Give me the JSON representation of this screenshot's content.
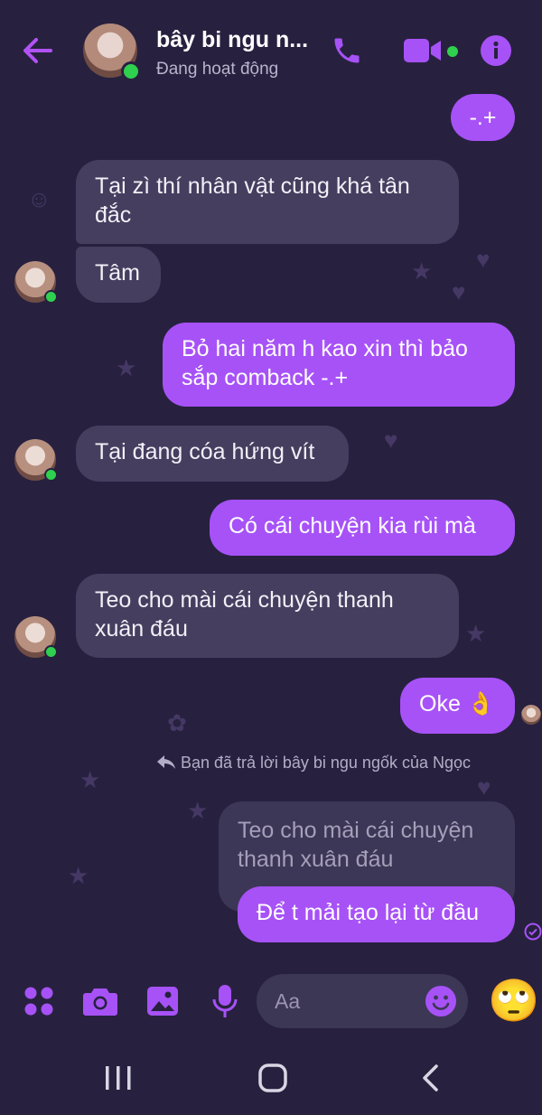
{
  "header": {
    "contact_name": "bây bi ngu n...",
    "status": "Đang hoạt động"
  },
  "messages": [
    {
      "text": "-.+"
    },
    {
      "text": "Tại zì thí nhân vật cũng khá tân đắc"
    },
    {
      "text": "Tâm"
    },
    {
      "text": "Bỏ hai năm h kao xin thì bảo sắp comback -.+"
    },
    {
      "text": "Tại đang cóa hứng vít"
    },
    {
      "text": "Có cái chuyện kia rùi mà"
    },
    {
      "text": "Teo cho mài cái chuyện thanh xuân đáu"
    },
    {
      "text": "Oke 👌"
    },
    {
      "text": "Teo cho mài cái chuyện thanh xuân đáu"
    },
    {
      "text": "Để t mải tạo lại từ đầu"
    }
  ],
  "reply_note": "Bạn đã trả lời bây bi ngu ngốk của Ngọc",
  "composer": {
    "placeholder": "Aa",
    "reaction_emoji": "🙄"
  },
  "colors": {
    "background": "#27213f",
    "accent": "#a752f7",
    "incoming_bubble": "#453e5f",
    "online": "#2fd04e"
  }
}
